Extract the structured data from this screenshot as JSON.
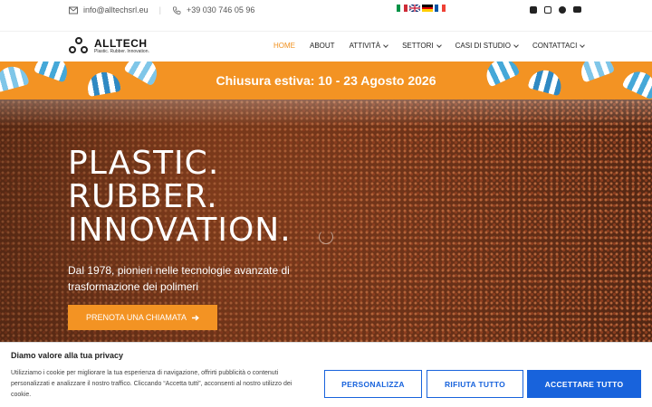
{
  "topbar": {
    "email": "info@alltechsrl.eu",
    "phone": "+39 030 746 05 96",
    "email_icon": "envelope-icon",
    "phone_icon": "phone-icon",
    "flags": [
      "italian-flag",
      "uk-flag",
      "german-flag",
      "french-flag"
    ],
    "social": [
      "linkedin-icon",
      "instagram-icon",
      "facebook-icon",
      "youtube-icon"
    ]
  },
  "logo": {
    "name": "ALLTECH",
    "tagline": "Plastic. Rubber. Innovation."
  },
  "menu": {
    "items": [
      {
        "label": "HOME",
        "active": true,
        "dropdown": false
      },
      {
        "label": "ABOUT",
        "active": false,
        "dropdown": false
      },
      {
        "label": "ATTIVITÀ",
        "active": false,
        "dropdown": true
      },
      {
        "label": "SETTORI",
        "active": false,
        "dropdown": true
      },
      {
        "label": "CASI DI STUDIO",
        "active": false,
        "dropdown": true
      },
      {
        "label": "CONTATTACI",
        "active": false,
        "dropdown": true
      }
    ],
    "accent": "#f0901e"
  },
  "banner": {
    "text": "Chiusura estiva: 10 - 23 Agosto 2026",
    "color": "#f39323"
  },
  "hero": {
    "line1": "PLASTIC.",
    "line2": "RUBBER.",
    "line3": "INNOVATION.",
    "subtitle": "Dal 1978, pionieri nelle tecnologie avanzate di trasformazione dei polimeri",
    "cta_label": "PRENOTA UNA CHIAMATA",
    "cta_icon": "arrow-right-icon"
  },
  "cookie": {
    "title": "Diamo valore alla tua privacy",
    "body": "Utilizziamo i cookie per migliorare la tua esperienza di navigazione, offrirti pubblicità o contenuti personalizzati e analizzare il nostro traffico. Cliccando “Accetta tutti”, acconsenti al nostro utilizzo dei cookie.",
    "customize": "PERSONALIZZA",
    "reject": "RIFIUTA TUTTO",
    "accept": "ACCETTARE TUTTO",
    "button_color": "#1863dc"
  }
}
